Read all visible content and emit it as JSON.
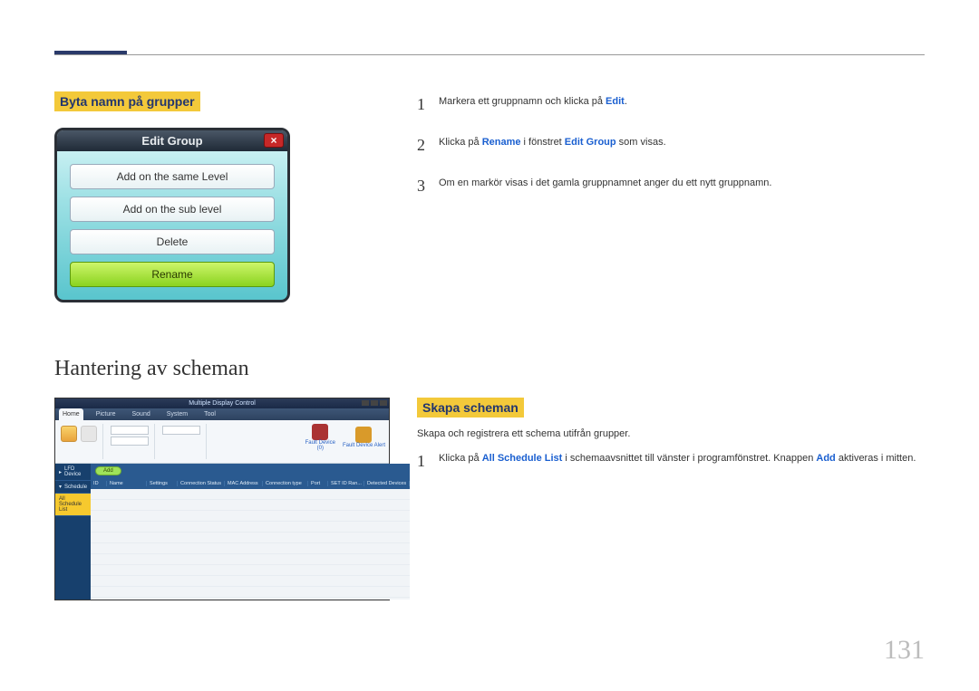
{
  "pageNumber": "131",
  "section1": {
    "heading": "Byta namn på grupper",
    "dialog": {
      "title": "Edit Group",
      "closeGlyph": "×",
      "buttons": {
        "sameLevel": "Add on the same Level",
        "subLevel": "Add on the sub level",
        "delete": "Delete",
        "rename": "Rename"
      }
    },
    "steps": [
      {
        "n": "1",
        "prefix": "Markera ett gruppnamn och klicka på ",
        "kw1": "Edit",
        "suffix": "."
      },
      {
        "n": "2",
        "prefix": "Klicka på ",
        "kw1": "Rename",
        "mid": " i fönstret ",
        "kw2": "Edit Group",
        "suffix": " som visas."
      },
      {
        "n": "3",
        "text": "Om en markör visas i det gamla gruppnamnet anger du ett nytt gruppnamn."
      }
    ]
  },
  "section2": {
    "heading": "Hantering av scheman",
    "subheading": "Skapa scheman",
    "intro": "Skapa och registrera ett schema utifrån grupper.",
    "steps": [
      {
        "n": "1",
        "prefix": "Klicka på ",
        "kw1": "All Schedule List",
        "mid": " i schemaavsnittet till vänster i programfönstret. Knappen ",
        "kw2": "Add",
        "suffix": " aktiveras i mitten."
      }
    ],
    "app": {
      "title": "Multiple Display Control",
      "tabs": [
        "Home",
        "Picture",
        "Sound",
        "System",
        "Tool"
      ],
      "fault1": {
        "label": "Fault Device",
        "count": "(0)"
      },
      "fault2": {
        "label": "Fault Device Alert"
      },
      "side": {
        "row1": "LFD Device",
        "row2": "Schedule",
        "row3": "All Schedule List",
        "addLabel": "Add"
      },
      "cols": [
        "ID",
        "Name",
        "Settings",
        "Connection Status",
        "MAC Address",
        "Connection type",
        "Port",
        "SET ID Ran...",
        "Detected Devices"
      ]
    }
  }
}
